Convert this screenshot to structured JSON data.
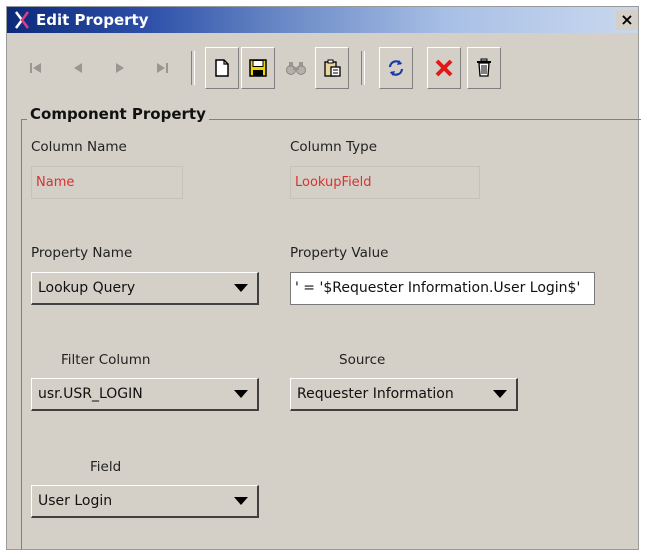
{
  "window": {
    "title": "Edit Property",
    "close_glyph": "×"
  },
  "toolbar": {
    "nav_buttons": [
      {
        "name": "first-record-icon"
      },
      {
        "name": "previous-record-icon"
      },
      {
        "name": "next-record-icon"
      },
      {
        "name": "last-record-icon"
      }
    ],
    "action_buttons": [
      {
        "name": "new-icon"
      },
      {
        "name": "save-icon"
      },
      {
        "name": "find-icon"
      },
      {
        "name": "paste-icon"
      },
      {
        "name": "refresh-icon"
      },
      {
        "name": "cancel-icon"
      },
      {
        "name": "delete-icon"
      }
    ]
  },
  "group": {
    "title": "Component Property"
  },
  "fields": {
    "column_name": {
      "label": "Column Name",
      "value": "Name"
    },
    "column_type": {
      "label": "Column Type",
      "value": "LookupField"
    },
    "property_name": {
      "label": "Property Name",
      "value": "Lookup Query"
    },
    "property_value": {
      "label": "Property Value",
      "value": "' = '$Requester Information.User Login$'"
    },
    "filter_column": {
      "label": "Filter Column",
      "value": "usr.USR_LOGIN"
    },
    "source": {
      "label": "Source",
      "value": "Requester Information"
    },
    "field": {
      "label": "Field",
      "value": "User Login"
    }
  },
  "colors": {
    "readonly_text": "#d7332f",
    "title_start": "#0b2a7a",
    "title_end": "#c9d8ee"
  }
}
